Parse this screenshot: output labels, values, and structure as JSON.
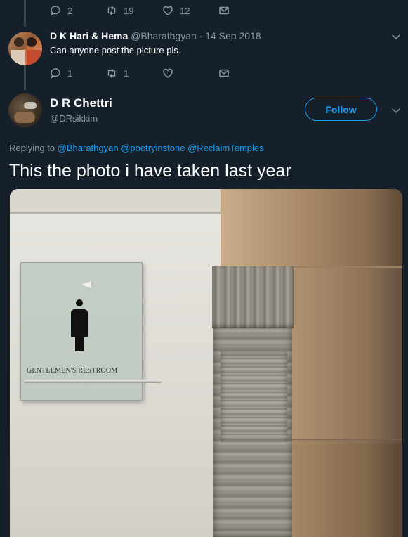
{
  "top_actions": {
    "replies": "2",
    "retweets": "19",
    "likes": "12"
  },
  "reply_tweet": {
    "name": "D K Hari & Hema",
    "handle": "@Bharathgyan",
    "separator": "·",
    "date": "14 Sep 2018",
    "text": "Can anyone post the picture pls.",
    "replies": "1",
    "retweets": "1",
    "likes": ""
  },
  "main_tweet": {
    "name": "D R Chettri",
    "handle": "@DRsikkim",
    "follow_label": "Follow",
    "replying_to_label": "Replying to",
    "mentions": [
      "@Bharathgyan",
      "@poetryinstone",
      "@ReclaimTemples"
    ],
    "text": "This the photo i have taken last year",
    "photo_sign_text": "GENTLEMEN'S RESTROOM"
  },
  "colors": {
    "background": "#15202b",
    "accent": "#1da1f2",
    "muted": "#8899a6"
  },
  "icons": [
    "reply-icon",
    "retweet-icon",
    "like-icon",
    "dm-icon",
    "chevron-down-icon"
  ]
}
